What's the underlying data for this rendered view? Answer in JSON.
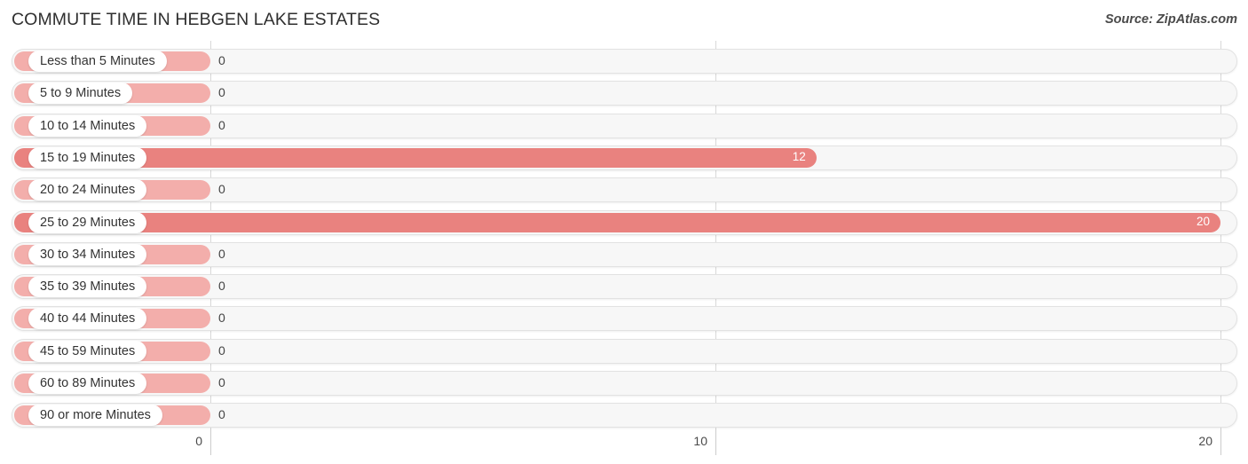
{
  "header": {
    "title": "COMMUTE TIME IN HEBGEN LAKE ESTATES",
    "source": "Source: ZipAtlas.com"
  },
  "colors": {
    "bar_zero": "#f3aeab",
    "bar_value": "#e9827f",
    "track": "#f7f7f7",
    "gridline": "#d8d8d8",
    "title_text": "#2f2f2f",
    "label_text": "#333333",
    "value_inside_text": "#ffffff",
    "value_outside_text": "#444444"
  },
  "chart_data": {
    "type": "bar",
    "orientation": "horizontal",
    "title": "COMMUTE TIME IN HEBGEN LAKE ESTATES",
    "subtitle": "",
    "xlabel": "",
    "ylabel": "",
    "xlim": [
      0,
      20
    ],
    "xticks": [
      0,
      10,
      20
    ],
    "xtick_labels": [
      "0",
      "10",
      "20"
    ],
    "grid": true,
    "legend": false,
    "categories": [
      "Less than 5 Minutes",
      "5 to 9 Minutes",
      "10 to 14 Minutes",
      "15 to 19 Minutes",
      "20 to 24 Minutes",
      "25 to 29 Minutes",
      "30 to 34 Minutes",
      "35 to 39 Minutes",
      "40 to 44 Minutes",
      "45 to 59 Minutes",
      "60 to 89 Minutes",
      "90 or more Minutes"
    ],
    "values": [
      0,
      0,
      0,
      12,
      0,
      20,
      0,
      0,
      0,
      0,
      0,
      0
    ],
    "value_labels": [
      "0",
      "0",
      "0",
      "12",
      "0",
      "20",
      "0",
      "0",
      "0",
      "0",
      "0",
      "0"
    ]
  }
}
